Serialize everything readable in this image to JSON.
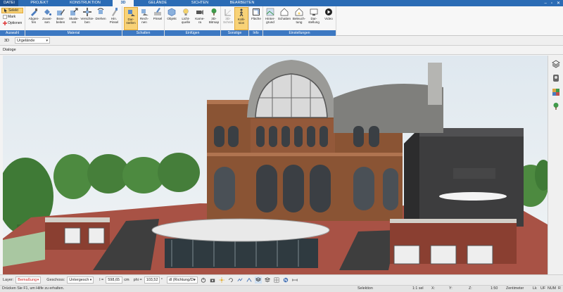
{
  "tabs": [
    "DATEI",
    "PROJEKT",
    "KONSTRUKTION",
    "3D",
    "GELÄNDE",
    "SICHTEN",
    "BEARBEITEN"
  ],
  "active_tab": "3D",
  "ribbon": {
    "selection": {
      "select": "Selekt",
      "mark": "Mark",
      "options": "Optionen",
      "group_label": "Auswahl"
    },
    "material": {
      "group_label": "Material",
      "buttons": [
        "Abgrei-\nfen",
        "Zuwei-\nsen",
        "Bear-\nbeiten",
        "Skalie-\nren",
        "Verschie-\nben",
        "Drehen",
        "Hin.\nPinsel"
      ]
    },
    "shadows": {
      "group_label": "Schatten",
      "buttons": [
        "Dar-\nstellen",
        "Rech-\nnen",
        "Pinsel"
      ]
    },
    "insert": {
      "group_label": "Einfügen",
      "buttons": [
        "Objekt",
        "Licht-\nquelle",
        "Kame-\nra",
        "3D-\nBitmap"
      ]
    },
    "other": {
      "group_label": "Sonstige",
      "buttons": [
        "3D-\nSchnitt",
        "Kolli-\nsion"
      ]
    },
    "info": {
      "group_label": "Info",
      "buttons": [
        "Fläche"
      ]
    },
    "settings": {
      "group_label": "Einstellungen",
      "buttons": [
        "Hinter-\ngrund",
        "Schatten",
        "Beleuch-\ntung",
        "Dar-\nstellung",
        "Video"
      ]
    }
  },
  "view": {
    "mode": "3D",
    "terrain_select": "Urgelände"
  },
  "dialog_label": "Dialoge",
  "inputbar": {
    "layer_label": "Layer:",
    "layer_value": "Bemaßung",
    "floor_label": "Geschoss:",
    "floor_value": "Untergesch",
    "l_label": "l =",
    "l_value": "598,65",
    "l_unit": "cm",
    "phi_label": "phi =",
    "phi_value": "103,52",
    "angle_unit": "°",
    "direction_value": "dl (Richtung/Di"
  },
  "statusbar": {
    "hint": "Drücken Sie F1, um Hilfe zu erhalten.",
    "mode": "Selektion",
    "scale1": "1:1 sel",
    "x": "X:",
    "y": "Y:",
    "z": "Z:",
    "scale2": "1:50",
    "unit": "Zentimeter",
    "flag1": "Lk",
    "flag2": "UF",
    "flag3": "NUM",
    "flag4": "R"
  },
  "colors": {
    "ribbon_blue": "#2b6cb5",
    "group_label_blue": "#3c78c2",
    "highlight": "#f8d277",
    "layer_red": "#c22222"
  }
}
